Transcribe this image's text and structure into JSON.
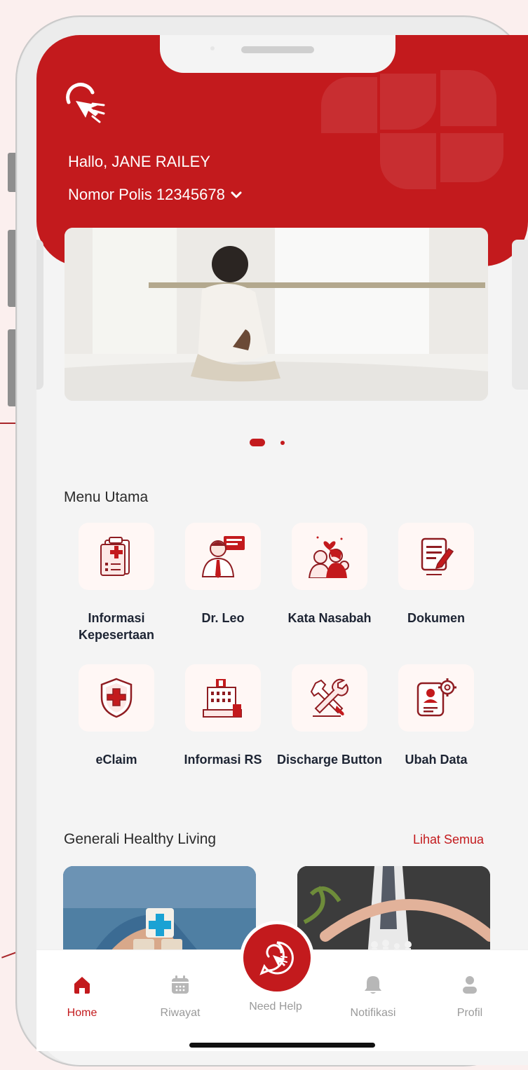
{
  "header": {
    "greeting": "Hallo, JANE RAILEY",
    "policy_label": "Nomor Polis 12345678"
  },
  "carousel": {
    "slides": 2,
    "active": 1
  },
  "main_menu": {
    "title": "Menu Utama",
    "items": [
      {
        "label": "Informasi Kepesertaan",
        "icon": "membership-clipboard-icon"
      },
      {
        "label": "Dr. Leo",
        "icon": "doctor-icon"
      },
      {
        "label": "Kata Nasabah",
        "icon": "family-icon"
      },
      {
        "label": "Dokumen",
        "icon": "document-edit-icon"
      },
      {
        "label": "eClaim",
        "icon": "shield-cross-icon"
      },
      {
        "label": "Informasi RS",
        "icon": "hospital-icon"
      },
      {
        "label": "Discharge Button",
        "icon": "tools-icon"
      },
      {
        "label": "Ubah Data",
        "icon": "profile-settings-icon"
      }
    ]
  },
  "healthy_living": {
    "title": "Generali Healthy Living",
    "see_all": "Lihat Semua"
  },
  "bottom_nav": {
    "items": [
      {
        "label": "Home",
        "icon": "home-icon",
        "active": true
      },
      {
        "label": "Riwayat",
        "icon": "calendar-icon"
      },
      {
        "label": "Need Help",
        "icon": "help-touch-icon"
      },
      {
        "label": "Notifikasi",
        "icon": "bell-icon"
      },
      {
        "label": "Profil",
        "icon": "user-icon"
      }
    ]
  },
  "colors": {
    "brand": "#c31a1d",
    "background": "#fbefee",
    "text_dark": "#1d2433"
  }
}
